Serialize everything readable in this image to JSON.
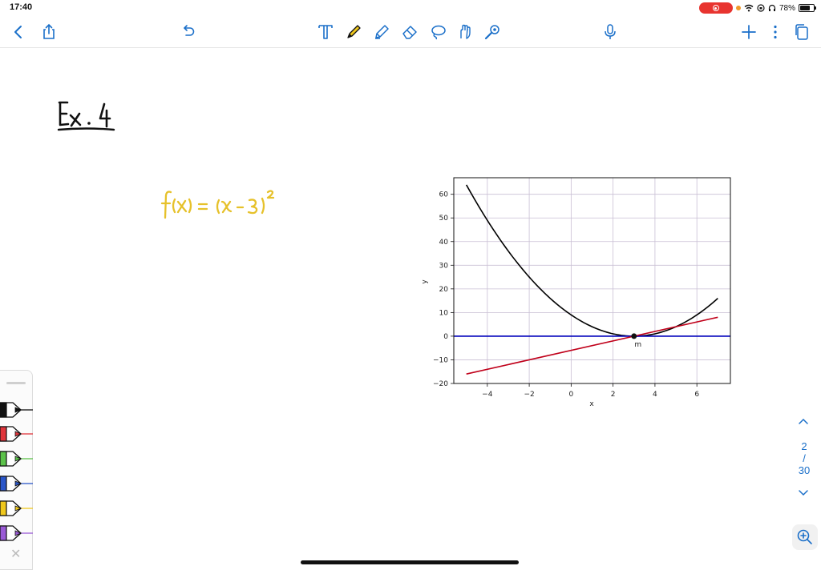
{
  "status_bar": {
    "time": "17:40",
    "battery": "78%",
    "battery_level": 0.78,
    "recording_color": "#e8342f"
  },
  "toolbar": {
    "left_icons": [
      "back-chevron-icon",
      "share-icon",
      "undo-icon"
    ],
    "center_tools": [
      "text-tool-icon",
      "pen-tool-icon",
      "highlighter-tool-icon",
      "eraser-tool-icon",
      "lasso-tool-icon",
      "shape-tool-icon",
      "laser-pointer-icon"
    ],
    "right_icons": [
      "microphone-icon",
      "add-page-icon",
      "more-icon",
      "pages-icon"
    ],
    "accent": "#1a6fc9"
  },
  "note": {
    "heading": "Ex. 4",
    "formula": "f(x) = (x - 3)²",
    "ink_color": "#111111",
    "highlight_color": "#e6c12a"
  },
  "chart_data": {
    "type": "line",
    "xlabel": "x",
    "ylabel": "y",
    "xlim": [
      -5.6,
      7.6
    ],
    "ylim": [
      -20,
      67
    ],
    "xticks": [
      -4,
      -2,
      0,
      2,
      4,
      6
    ],
    "yticks": [
      -20,
      -10,
      0,
      10,
      20,
      30,
      40,
      50,
      60
    ],
    "grid": true,
    "series": [
      {
        "function": "(x-3)^2",
        "x_range": [
          -5,
          7
        ],
        "color": "#000000"
      },
      {
        "function": "y=0",
        "x_range": [
          -5.6,
          7.6
        ],
        "color": "#0000bb"
      },
      {
        "points": [
          [
            -5,
            -16
          ],
          [
            7,
            8
          ]
        ],
        "color": "#c0001a"
      }
    ],
    "annotations": [
      {
        "x": 3,
        "y": 0,
        "text": "m"
      }
    ]
  },
  "pen_palette": {
    "pens": [
      {
        "name": "black",
        "color": "#111111"
      },
      {
        "name": "red",
        "color": "#e0353b"
      },
      {
        "name": "green",
        "color": "#5cc24a"
      },
      {
        "name": "blue",
        "color": "#2a56c9"
      },
      {
        "name": "yellow",
        "color": "#f0c81c"
      },
      {
        "name": "purple",
        "color": "#9a5ad6"
      }
    ]
  },
  "page_nav": {
    "current": "2",
    "separator": "/",
    "total": "30"
  }
}
